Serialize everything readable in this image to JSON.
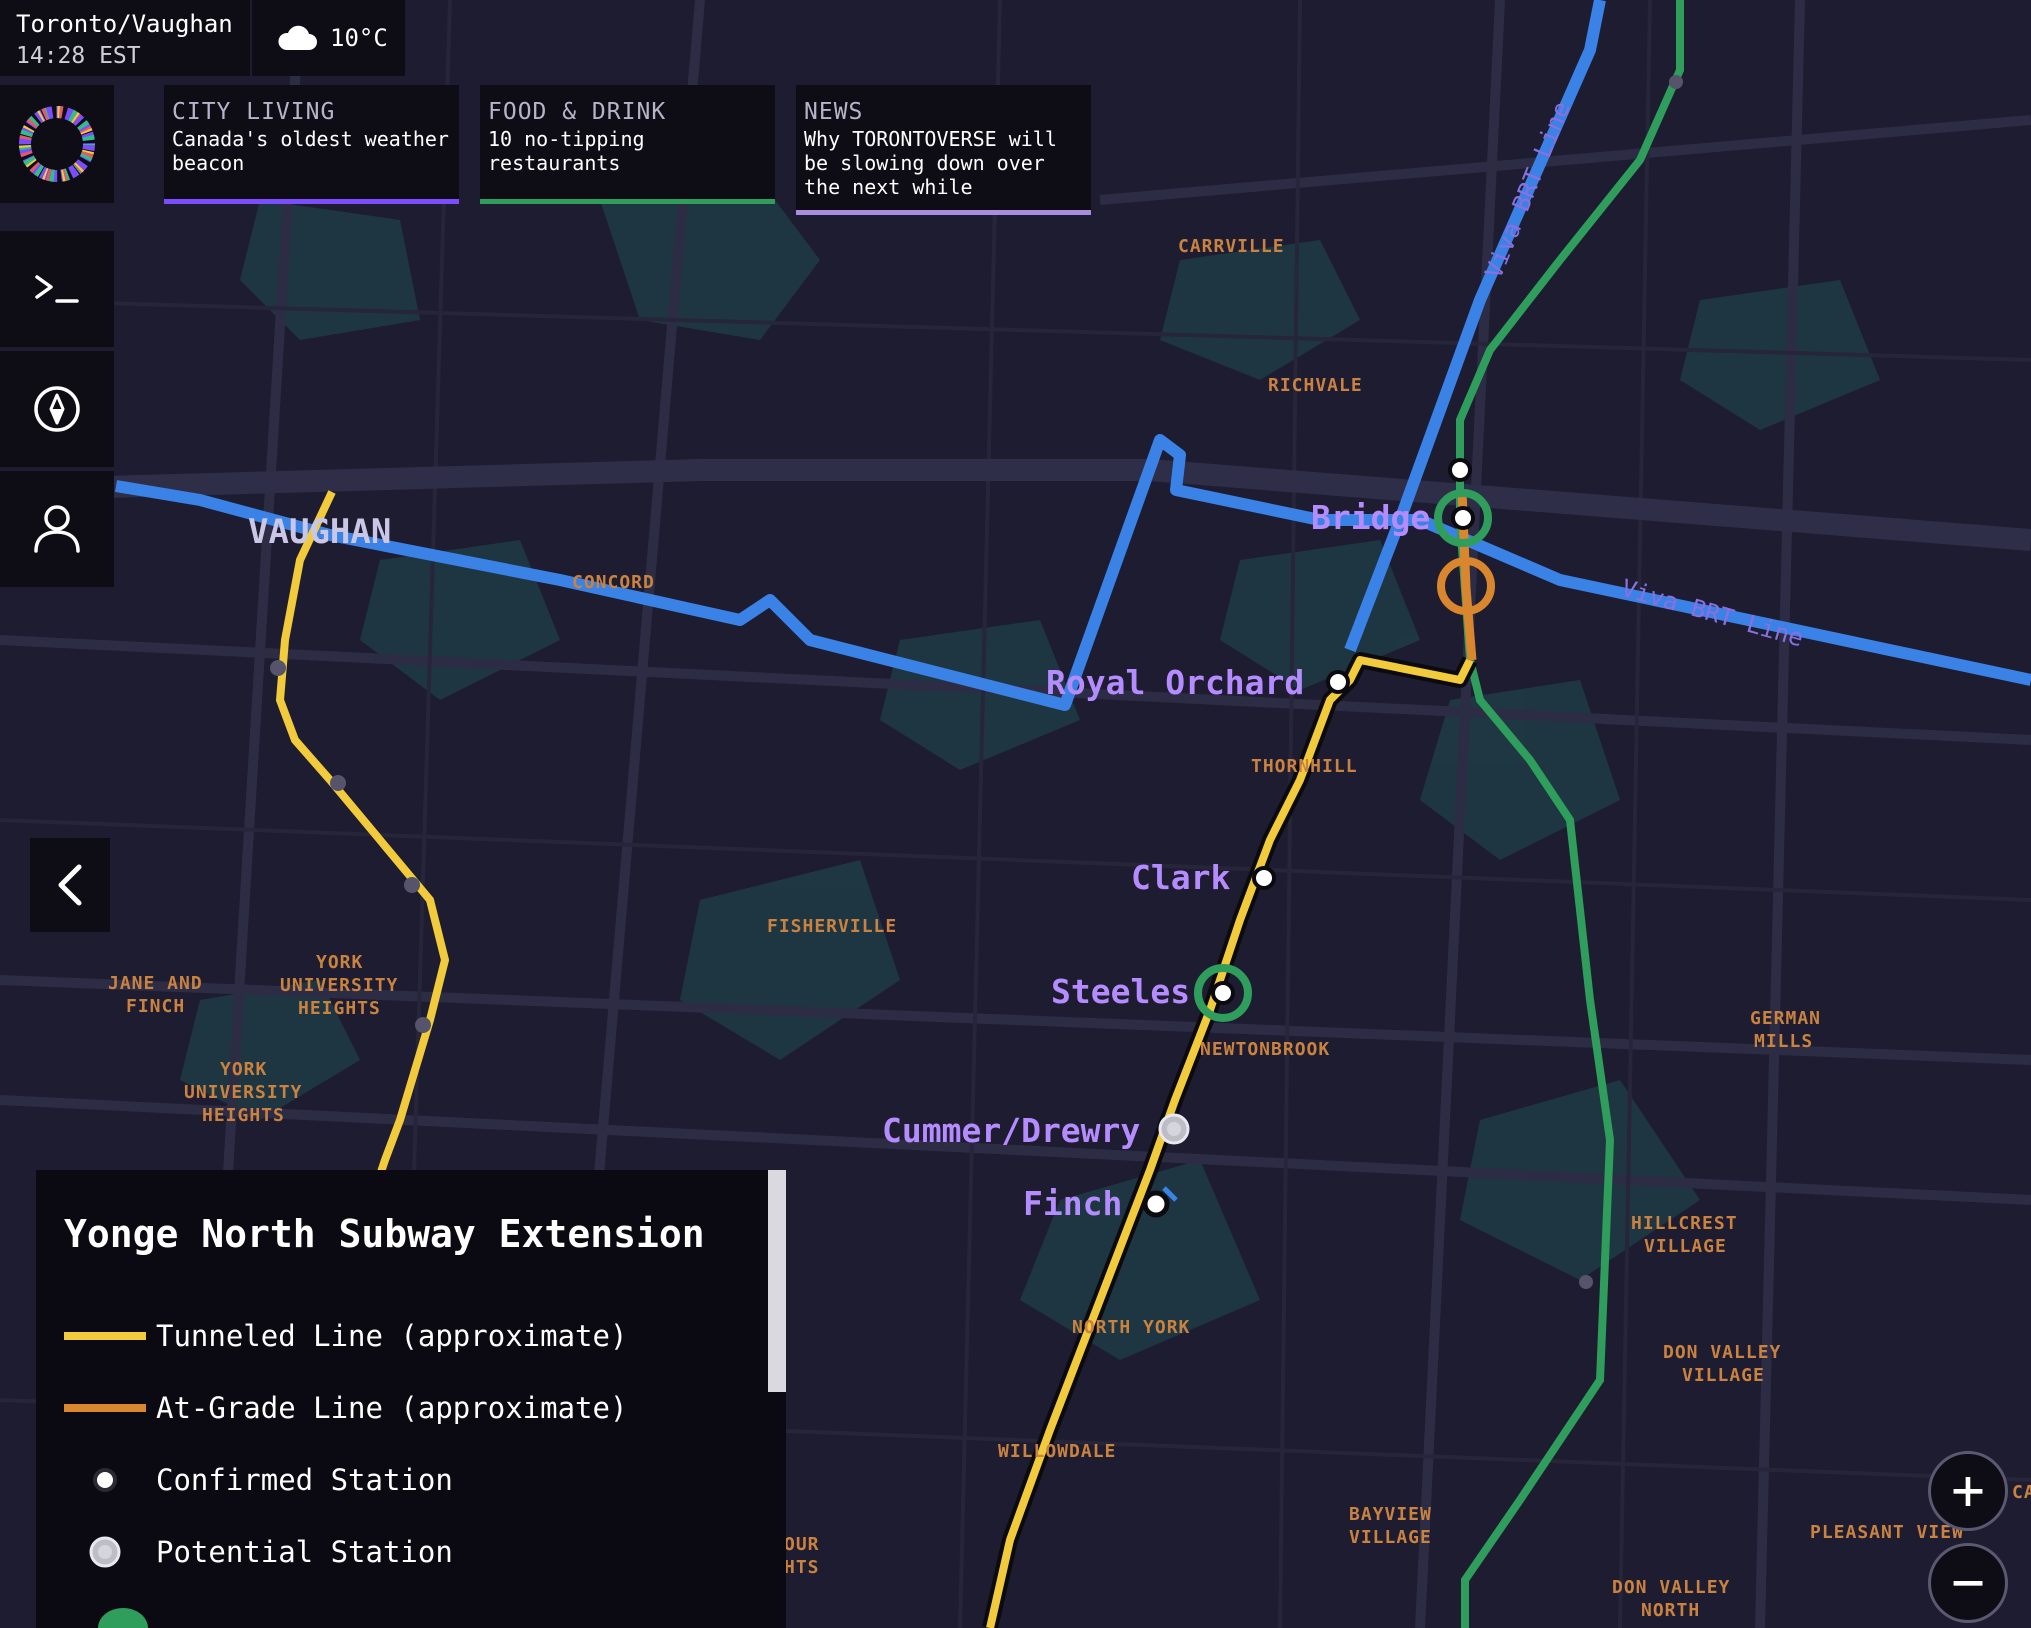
{
  "header": {
    "location": "Toronto/Vaughan",
    "time": "14:28 EST",
    "weather_icon": "cloud-icon",
    "temperature": "10°C"
  },
  "news": [
    {
      "category": "CITY LIVING",
      "text": "Canada's oldest weather beacon",
      "accent": "#7b4dff"
    },
    {
      "category": "FOOD & DRINK",
      "text": "10 no-tipping restaurants",
      "accent": "#2f9e5d"
    },
    {
      "category": "NEWS",
      "text": "Why TORONTOVERSE will be slowing down over the next while",
      "accent": "#a98ee0"
    }
  ],
  "sidebar": {
    "items": [
      {
        "icon": "terminal-icon"
      },
      {
        "icon": "compass-icon"
      },
      {
        "icon": "user-icon"
      }
    ],
    "collapse_icon": "chevron-left-icon"
  },
  "map": {
    "city": "VAUGHAN",
    "neighbourhoods": [
      "CARRVILLE",
      "RICHVALE",
      "CONCORD",
      "THORNHILL",
      "FISHERVILLE",
      "NEWTONBROOK",
      "JANE AND FINCH",
      "YORK UNIVERSITY HEIGHTS",
      "YORK UNIVERSITY HEIGHTS",
      "GERMAN MILLS",
      "HILLCREST VILLAGE",
      "DON VALLEY VILLAGE",
      "NORTH YORK",
      "WILLOWDALE",
      "BAYVIEW VILLAGE",
      "PLEASANT VIEW",
      "DON VALLEY NORTH"
    ],
    "stations": [
      "Bridge",
      "Royal Orchard",
      "Clark",
      "Steeles",
      "Cummer/Drewry",
      "Finch"
    ],
    "line_labels": [
      "Viva BRT Line",
      "Viva BRT Line"
    ],
    "colors": {
      "tunneled": "#f2cb3c",
      "at_grade": "#d9862e",
      "brt": "#3b82e6",
      "green_line": "#2f9e5d",
      "station_label": "#b58cff",
      "neighbourhood": "#c9823f"
    }
  },
  "legend": {
    "title": "Yonge North Subway Extension",
    "items": [
      {
        "label": "Tunneled Line (approximate)",
        "kind": "line",
        "color": "#f2cb3c"
      },
      {
        "label": "At-Grade Line (approximate)",
        "kind": "line",
        "color": "#d9862e"
      },
      {
        "label": "Confirmed Station",
        "kind": "confirmed"
      },
      {
        "label": "Potential Station",
        "kind": "potential"
      }
    ]
  },
  "zoom": {
    "in": "+",
    "out": "−"
  }
}
